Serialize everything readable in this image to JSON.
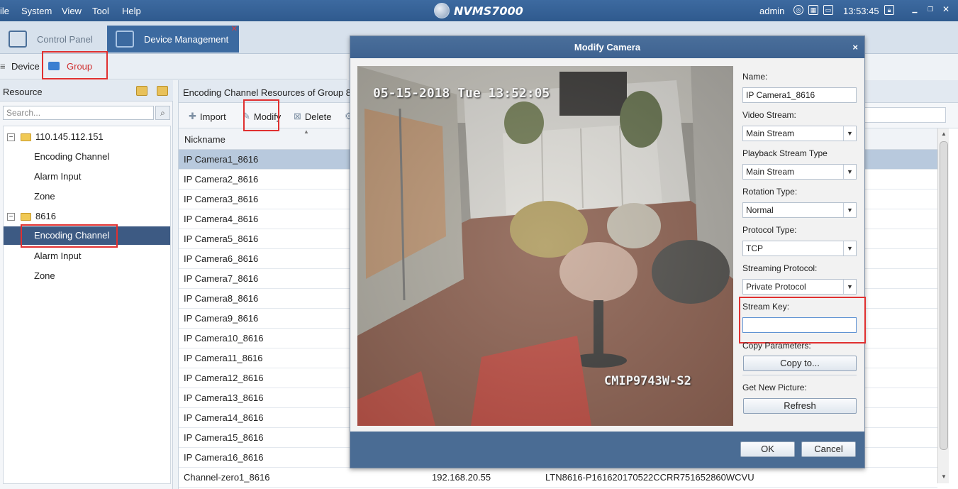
{
  "menubar": {
    "items": [
      "ile",
      "System",
      "View",
      "Tool",
      "Help"
    ],
    "app_title": "NVMS7000",
    "user": "admin",
    "time": "13:53:45",
    "icons": [
      "globe-icon",
      "lock-icon",
      "minimize-icon",
      "restore-icon",
      "close-icon"
    ]
  },
  "tabs": {
    "control_panel": "Control Panel",
    "device_management": "Device Management"
  },
  "subtabs": {
    "device": "Device",
    "group": "Group"
  },
  "left_panel": {
    "title": "Resource",
    "search_placeholder": "Search...",
    "tree": [
      {
        "label": "110.145.112.151",
        "type": "group"
      },
      {
        "label": "Encoding Channel",
        "type": "leaf"
      },
      {
        "label": "Alarm Input",
        "type": "leaf"
      },
      {
        "label": "Zone",
        "type": "leaf"
      },
      {
        "label": "8616",
        "type": "group"
      },
      {
        "label": "Encoding Channel",
        "type": "leaf",
        "selected": true
      },
      {
        "label": "Alarm Input",
        "type": "leaf"
      },
      {
        "label": "Zone",
        "type": "leaf"
      }
    ]
  },
  "right_panel": {
    "title": "Encoding Channel Resources of Group 861",
    "toolbar": {
      "import": "Import",
      "modify": "Modify",
      "delete": "Delete"
    },
    "column_nickname": "Nickname",
    "rows": [
      "IP Camera1_8616",
      "IP Camera2_8616",
      "IP Camera3_8616",
      "IP Camera4_8616",
      "IP Camera5_8616",
      "IP Camera6_8616",
      "IP Camera7_8616",
      "IP Camera8_8616",
      "IP Camera9_8616",
      "IP Camera10_8616",
      "IP Camera11_8616",
      "IP Camera12_8616",
      "IP Camera13_8616",
      "IP Camera14_8616",
      "IP Camera15_8616",
      "IP Camera16_8616"
    ],
    "last_row": {
      "name": "Channel-zero1_8616",
      "ip": "192.168.20.55",
      "serial": "LTN8616-P161620170522CCRR751652860WCVU"
    }
  },
  "modal": {
    "title": "Modify Camera",
    "close": "×",
    "camera_timestamp": "05-15-2018 Tue 13:52:05",
    "camera_label": "CMIP9743W-S2",
    "name_label": "Name:",
    "name_value": "IP Camera1_8616",
    "video_stream_label": "Video Stream:",
    "video_stream_value": "Main Stream",
    "playback_label": "Playback Stream Type",
    "playback_value": "Main Stream",
    "rotation_label": "Rotation Type:",
    "rotation_value": "Normal",
    "protocol_label": "Protocol Type:",
    "protocol_value": "TCP",
    "streaming_label": "Streaming Protocol:",
    "streaming_value": "Private Protocol",
    "stream_key_label": "Stream Key:",
    "stream_key_value": "",
    "copy_label": "Copy Parameters:",
    "copy_button": "Copy to...",
    "new_picture_label": "Get New Picture:",
    "refresh_button": "Refresh",
    "ok": "OK",
    "cancel": "Cancel"
  },
  "colors": {
    "menubar": "#2f5a8e",
    "highlight": "#e03030",
    "selected_row": "#b8c9dd",
    "selected_tree": "#3d5a83"
  }
}
